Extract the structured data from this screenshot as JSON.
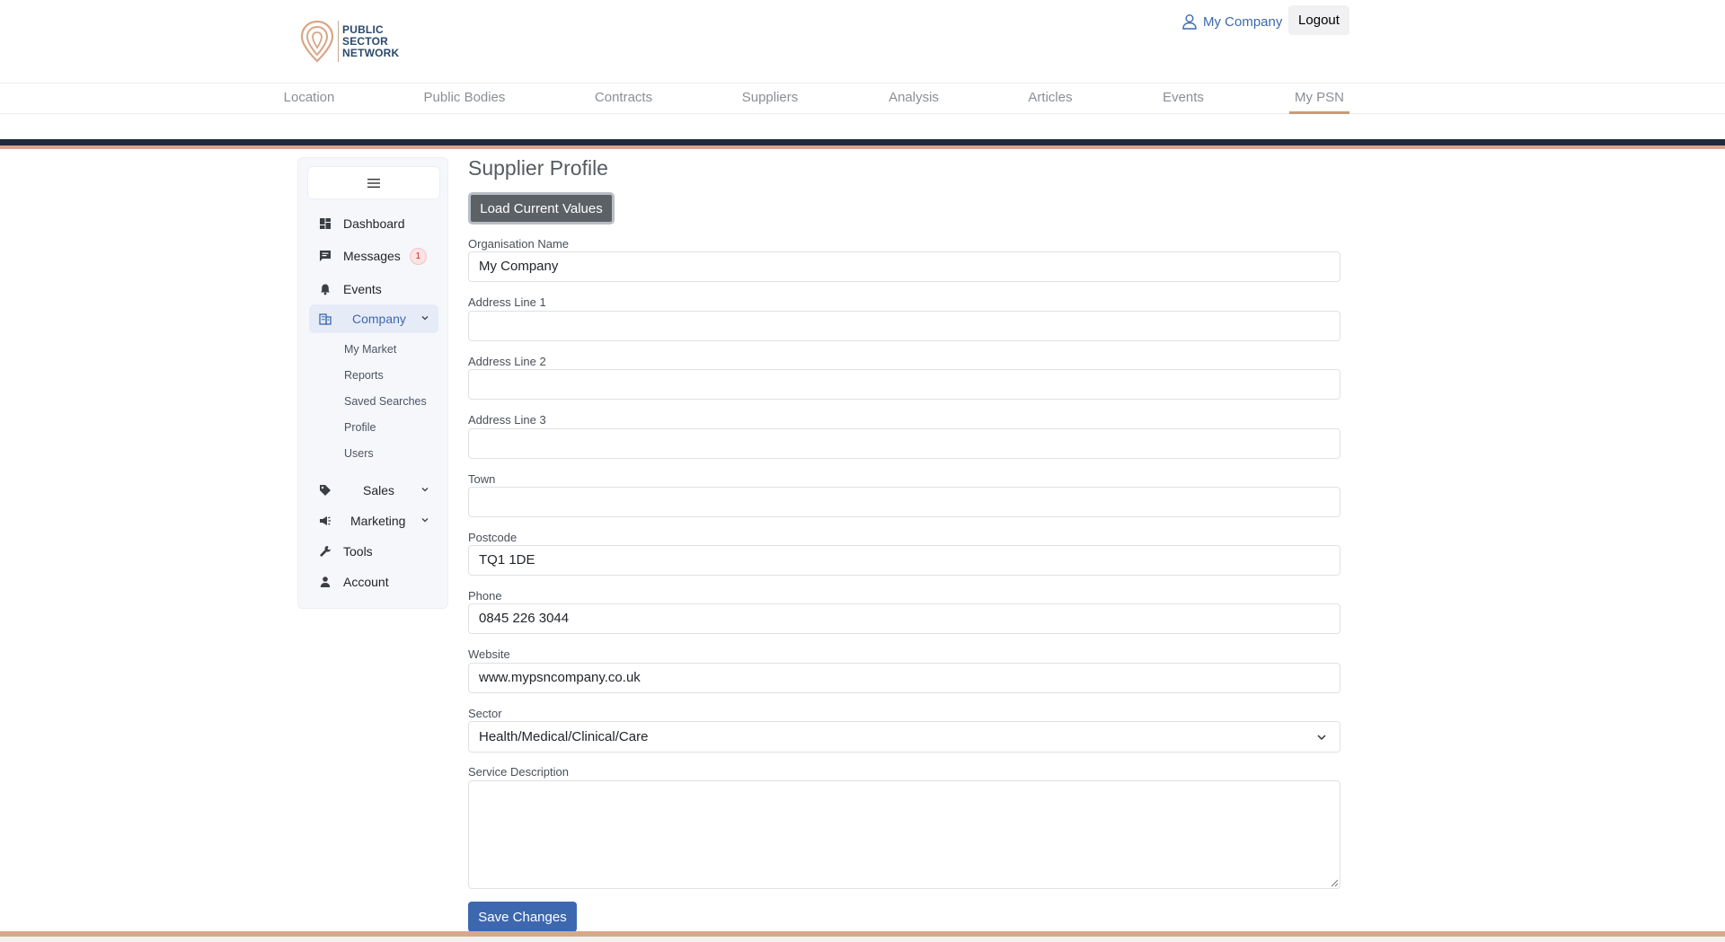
{
  "brand": {
    "line1": "PUBLIC",
    "line2": "SECTOR",
    "line3": "NETWORK",
    "accent": "#d4a98a",
    "primary": "#3d68b0",
    "dark": "#1f2a3c"
  },
  "header": {
    "user_label": "My Company",
    "logout_label": "Logout"
  },
  "nav": {
    "items": [
      {
        "label": "Location"
      },
      {
        "label": "Public Bodies"
      },
      {
        "label": "Contracts"
      },
      {
        "label": "Suppliers"
      },
      {
        "label": "Analysis"
      },
      {
        "label": "Articles"
      },
      {
        "label": "Events"
      },
      {
        "label": "My PSN"
      }
    ],
    "active": "My PSN"
  },
  "sidebar": {
    "items": [
      {
        "label": "Dashboard",
        "icon": "dashboard-icon"
      },
      {
        "label": "Messages",
        "icon": "chat-icon",
        "badge": "1"
      },
      {
        "label": "Events",
        "icon": "bell-icon"
      },
      {
        "label": "Company",
        "icon": "building-icon",
        "expanded": true
      },
      {
        "label": "Sales",
        "icon": "tag-icon"
      },
      {
        "label": "Marketing",
        "icon": "megaphone-icon"
      },
      {
        "label": "Tools",
        "icon": "wrench-icon"
      },
      {
        "label": "Account",
        "icon": "person-icon"
      }
    ],
    "company_sub": [
      "My Market",
      "Reports",
      "Saved Searches",
      "Profile",
      "Users"
    ]
  },
  "form": {
    "title": "Supplier Profile",
    "load_label": "Load Current Values",
    "save_label": "Save Changes",
    "fields": {
      "org_name": {
        "label": "Organisation Name",
        "value": "My Company"
      },
      "address1": {
        "label": "Address Line 1",
        "value": ""
      },
      "address2": {
        "label": "Address Line 2",
        "value": ""
      },
      "address3": {
        "label": "Address Line 3",
        "value": ""
      },
      "town": {
        "label": "Town",
        "value": ""
      },
      "postcode": {
        "label": "Postcode",
        "value": "TQ1 1DE"
      },
      "phone": {
        "label": "Phone",
        "value": "0845 226 3044"
      },
      "website": {
        "label": "Website",
        "value": "www.mypsncompany.co.uk"
      },
      "sector": {
        "label": "Sector",
        "value": "Health/Medical/Clinical/Care"
      },
      "service_description": {
        "label": "Service Description",
        "value": ""
      }
    }
  }
}
